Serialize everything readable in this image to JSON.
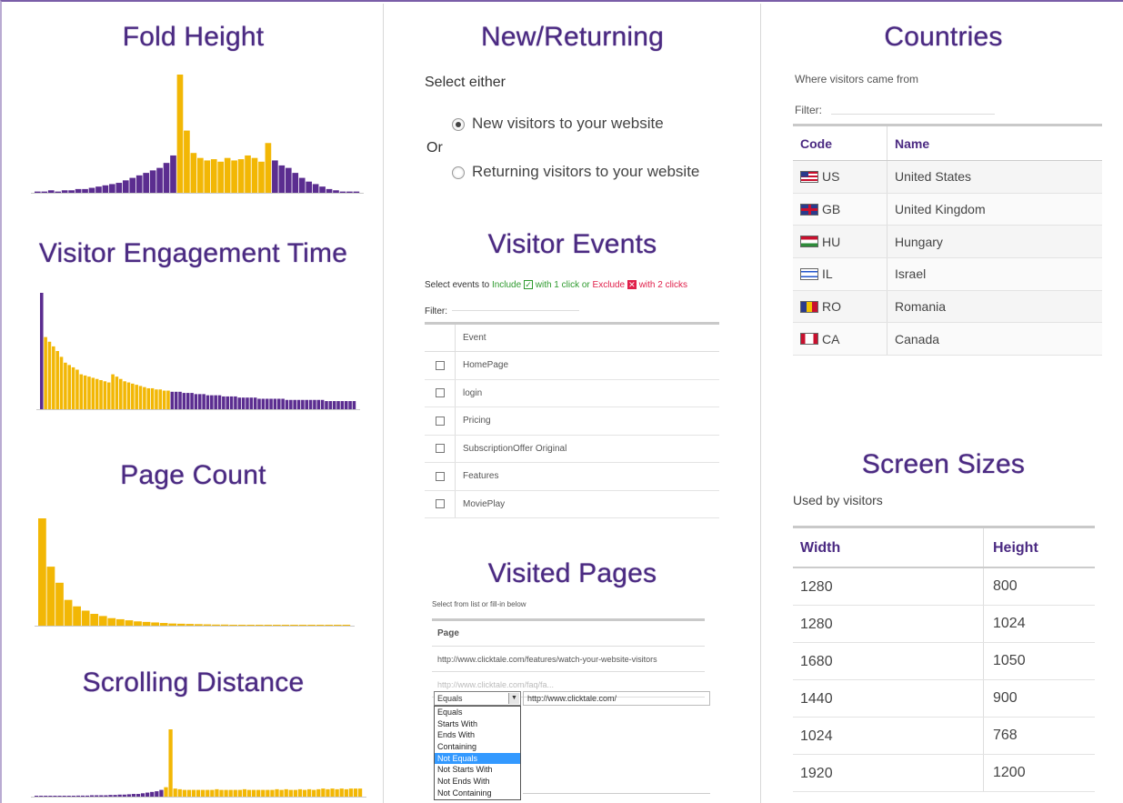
{
  "fold_height": {
    "title": "Fold Height",
    "chart_data": {
      "type": "bar",
      "title": "Fold Height",
      "highlight_color": "#f2b705",
      "base_color": "#5b2d90",
      "values": [
        1,
        1,
        2,
        1,
        2,
        2,
        3,
        3,
        4,
        5,
        6,
        7,
        8,
        10,
        12,
        14,
        16,
        18,
        20,
        24,
        30,
        95,
        50,
        32,
        28,
        26,
        27,
        25,
        28,
        26,
        27,
        30,
        28,
        25,
        40,
        26,
        22,
        20,
        16,
        12,
        9,
        7,
        5,
        3,
        2,
        1,
        1,
        1
      ],
      "highlight_range": [
        21,
        34
      ]
    }
  },
  "engagement_time": {
    "title": "Visitor Engagement Time",
    "chart_data": {
      "type": "bar",
      "title": "Visitor Engagement Time",
      "highlight_color": "#f2b705",
      "base_color": "#5b2d90",
      "values": [
        100,
        62,
        58,
        54,
        50,
        45,
        40,
        38,
        36,
        34,
        30,
        29,
        28,
        27,
        26,
        25,
        24,
        23,
        30,
        28,
        26,
        24,
        23,
        22,
        21,
        20,
        19,
        18,
        18,
        17,
        17,
        16,
        16,
        15,
        15,
        15,
        14,
        14,
        14,
        13,
        13,
        13,
        12,
        12,
        12,
        12,
        11,
        11,
        11,
        11,
        10,
        10,
        10,
        10,
        10,
        9,
        9,
        9,
        9,
        9,
        9,
        9,
        8,
        8,
        8,
        8,
        8,
        8,
        8,
        8,
        8,
        8,
        7,
        7,
        7,
        7,
        7,
        7,
        7,
        7
      ],
      "highlight_range": [
        1,
        32
      ]
    }
  },
  "page_count": {
    "title": "Page Count",
    "chart_data": {
      "type": "bar",
      "title": "Page Count",
      "color": "#f2b705",
      "values": [
        100,
        55,
        40,
        24,
        18,
        14,
        11,
        9,
        7,
        6,
        5,
        4,
        3.5,
        3,
        2.5,
        2,
        1.8,
        1.6,
        1.4,
        1.2,
        1,
        1,
        0.8,
        0.8,
        0.6,
        0.6,
        0.5,
        0.5,
        0.4,
        0.4,
        0.3,
        0.3,
        0.3,
        0.2,
        0.2,
        0.2
      ]
    }
  },
  "scrolling_distance": {
    "title": "Scrolling Distance",
    "chart_data": {
      "type": "bar",
      "title": "Scrolling Distance",
      "highlight_color": "#f2b705",
      "base_color": "#5b2d90",
      "values": [
        1,
        1,
        1,
        1,
        1,
        1,
        1,
        1,
        1,
        1.5,
        1.5,
        1.5,
        2,
        2,
        2,
        2,
        2.5,
        2.5,
        3,
        3,
        3.5,
        4,
        4,
        5,
        6,
        7,
        8,
        10,
        14,
        100,
        12,
        11,
        10,
        10,
        10,
        10,
        10,
        10,
        10,
        11,
        10,
        10,
        10,
        10,
        10,
        11,
        10,
        10,
        10,
        10,
        10,
        10,
        11,
        10,
        11,
        10,
        10,
        11,
        10,
        11,
        10,
        11,
        12,
        11,
        12,
        11,
        12,
        11,
        12,
        12,
        12
      ],
      "highlight_range": [
        28,
        70
      ]
    }
  },
  "new_returning": {
    "title": "New/Returning",
    "select_label": "Select either",
    "option_new": "New visitors to your website",
    "or_label": "Or",
    "option_returning": "Returning visitors to your website",
    "selected": "new"
  },
  "visitor_events": {
    "title": "Visitor Events",
    "instr_pre": "Select events to",
    "instr_include": "Include",
    "instr_mid": "with 1 click or",
    "instr_exclude": "Exclude",
    "instr_post": "with 2 clicks",
    "filter_label": "Filter:",
    "column": "Event",
    "rows": [
      "HomePage",
      "login",
      "Pricing",
      "SubscriptionOffer Original",
      "Features",
      "MoviePlay"
    ]
  },
  "visited_pages": {
    "title": "Visited Pages",
    "instr": "Select from list or fill-in below",
    "column": "Page",
    "rows": [
      "http://www.clicktale.com/features/watch-your-website-visitors",
      "http://www.clicktale.com/faq/fa..."
    ],
    "operator_value": "Equals",
    "url_value": "http://www.clicktale.com/",
    "operator_options": [
      "Equals",
      "Starts With",
      "Ends With",
      "Containing",
      "Not Equals",
      "Not Starts With",
      "Not Ends With",
      "Not Containing"
    ],
    "highlighted_option": "Not Equals"
  },
  "countries": {
    "title": "Countries",
    "subtitle": "Where visitors came from",
    "filter_label": "Filter:",
    "col_code": "Code",
    "col_name": "Name",
    "rows": [
      {
        "code": "US",
        "name": "United States",
        "flag": "us-flag-icon"
      },
      {
        "code": "GB",
        "name": "United Kingdom",
        "flag": "gb-flag-icon"
      },
      {
        "code": "HU",
        "name": "Hungary",
        "flag": "hu-flag-icon"
      },
      {
        "code": "IL",
        "name": "Israel",
        "flag": "il-flag-icon"
      },
      {
        "code": "RO",
        "name": "Romania",
        "flag": "ro-flag-icon"
      },
      {
        "code": "CA",
        "name": "Canada",
        "flag": "ca-flag-icon"
      }
    ]
  },
  "screen_sizes": {
    "title": "Screen Sizes",
    "subtitle": "Used by visitors",
    "col_width": "Width",
    "col_height": "Height",
    "rows": [
      {
        "width": "1280",
        "height": "800"
      },
      {
        "width": "1280",
        "height": "1024"
      },
      {
        "width": "1680",
        "height": "1050"
      },
      {
        "width": "1440",
        "height": "900"
      },
      {
        "width": "1024",
        "height": "768"
      },
      {
        "width": "1920",
        "height": "1200"
      }
    ]
  },
  "colors": {
    "accent": "#4b2a82",
    "include": "#2e9a2e",
    "exclude": "#e0204b",
    "highlight": "#f2b705",
    "purple_bar": "#5b2d90"
  }
}
